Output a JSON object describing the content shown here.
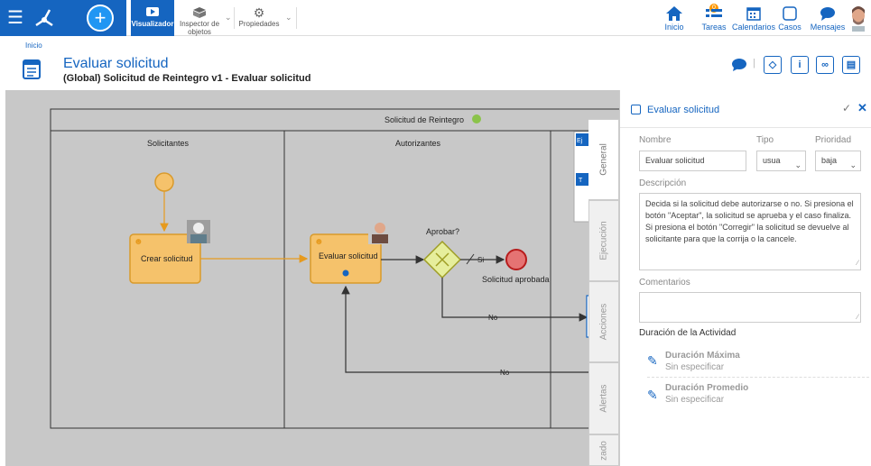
{
  "toolbar": {
    "visualizer": "Visualizador",
    "inspector_l1": "Inspector de",
    "inspector_l2": "objetos",
    "properties": "Propiedades"
  },
  "nav": {
    "inicio": "Inicio",
    "tareas": "Tareas",
    "tareas_badge": "0",
    "calendarios": "Calendarios",
    "casos": "Casos",
    "mensajes": "Mensajes"
  },
  "breadcrumb": "Inicio",
  "page": {
    "title": "Evaluar solicitud",
    "subtitle": "(Global) Solicitud de Reintegro v1 - Evaluar solicitud"
  },
  "diagram": {
    "pool": "Solicitud de Reintegro",
    "lanes": [
      "Solicitantes",
      "Autorizantes"
    ],
    "task1": "Crear solicitud",
    "task2": "Evaluar solicitud",
    "gateway": "Aprobar?",
    "end_event": "Solicitud aprobada",
    "flow_si": "Si",
    "flow_no1": "No",
    "flow_no2": "No",
    "hidden_lane_label": "Ej",
    "hidden_lane_label2": "T"
  },
  "tabs": [
    "General",
    "Ejecución",
    "Acciones",
    "Alertas",
    "zado"
  ],
  "panel": {
    "title": "Evaluar solicitud",
    "nombre_label": "Nombre",
    "nombre_value": "Evaluar solicitud",
    "tipo_label": "Tipo",
    "tipo_value": "usua",
    "prioridad_label": "Prioridad",
    "prioridad_value": "baja",
    "descripcion_label": "Descripción",
    "descripcion_value": "Decida si la solicitud debe autorizarse o no. Si presiona el botón \"Aceptar\", la solicitud se aprueba y el caso finaliza. Si presiona el botón \"Corregir\" la solicitud se devuelve al solicitante para que la corrija o la cancele.",
    "comentarios_label": "Comentarios",
    "comentarios_value": "",
    "duracion_label": "Duración de la Actividad",
    "dur_max_title": "Duración Máxima",
    "dur_max_value": "Sin especificar",
    "dur_avg_title": "Duración Promedio",
    "dur_avg_value": "Sin especificar"
  },
  "colors": {
    "brand": "#1565c0",
    "task_fill": "#f5c26b",
    "task_border": "#d99a2b",
    "start_event": "#f5c26b",
    "end_event": "#e57373",
    "gateway": "#e6ee9c"
  },
  "icons": [
    "menu-icon",
    "logo-icon",
    "plus-icon",
    "visualizer-icon",
    "inspector-icon",
    "gear-icon",
    "home-icon",
    "tasks-icon",
    "calendar-icon",
    "cases-icon",
    "messages-icon",
    "chat-icon",
    "help-icon",
    "info-icon",
    "attach-icon",
    "layout-icon",
    "pencil-icon",
    "check-icon",
    "close-icon"
  ]
}
